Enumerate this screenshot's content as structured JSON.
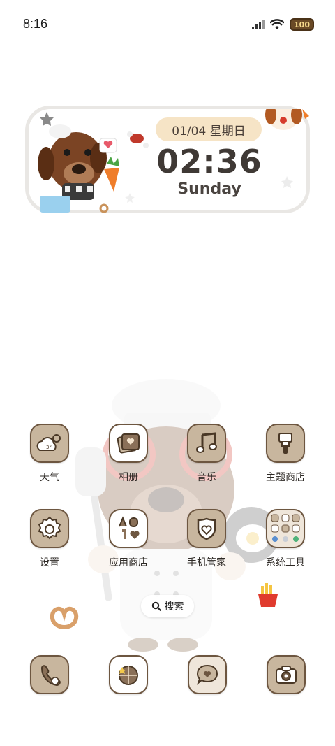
{
  "status_bar": {
    "time": "8:16",
    "battery": "100",
    "icons": [
      "signal-icon",
      "wifi-icon",
      "battery-icon"
    ]
  },
  "clock_widget": {
    "date": "01/04  星期日",
    "time": "02:36",
    "weekday": "Sunday"
  },
  "apps": [
    {
      "label": "天气",
      "icon": "weather-icon"
    },
    {
      "label": "相册",
      "icon": "gallery-icon"
    },
    {
      "label": "音乐",
      "icon": "music-icon"
    },
    {
      "label": "主题商店",
      "icon": "theme-store-icon"
    },
    {
      "label": "设置",
      "icon": "settings-icon"
    },
    {
      "label": "应用商店",
      "icon": "app-store-icon"
    },
    {
      "label": "手机管家",
      "icon": "phone-manager-icon"
    },
    {
      "label": "系统工具",
      "icon": "system-tools-folder-icon"
    }
  ],
  "weather_icon_text": "3°",
  "search": {
    "label": "搜索",
    "icon": "search-icon"
  },
  "dock": [
    {
      "icon": "phone-icon"
    },
    {
      "icon": "browser-icon"
    },
    {
      "icon": "messages-icon"
    },
    {
      "icon": "camera-icon"
    }
  ],
  "colors": {
    "icon_tan": "#c8b69e",
    "icon_border": "#6d5640",
    "date_pill": "#f6e4c6",
    "clock_text": "#3f3935",
    "battery": "#6a4a26"
  }
}
